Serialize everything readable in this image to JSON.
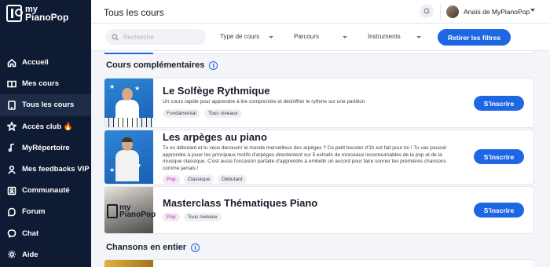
{
  "logo": {
    "line1": "my",
    "line2": "PianoPop"
  },
  "sidebar": {
    "items": [
      {
        "label": "Accueil",
        "icon": "home-icon"
      },
      {
        "label": "Mes cours",
        "icon": "book-icon"
      },
      {
        "label": "Tous les cours",
        "icon": "tablet-icon",
        "active": true
      },
      {
        "label": "Accès club 🔥",
        "icon": "star-icon"
      },
      {
        "label": "MyRépertoire",
        "icon": "music-note-icon"
      },
      {
        "label": "Mes feedbacks VIP",
        "icon": "user-icon"
      },
      {
        "label": "Communauté",
        "icon": "contacts-icon"
      },
      {
        "label": "Forum",
        "icon": "forum-icon"
      },
      {
        "label": "Chat",
        "icon": "chat-icon"
      },
      {
        "label": "Aide",
        "icon": "help-icon"
      }
    ]
  },
  "header": {
    "title": "Tous les cours",
    "user_name": "Anaïs de MyPianoPop"
  },
  "filters": {
    "search_placeholder": "Recherche",
    "type_label": "Type de cours",
    "parcours_label": "Parcours",
    "instruments_label": "Instruments",
    "reset_label": "Retirer les filtres"
  },
  "sections": {
    "complementary": "Cours complémentaires",
    "full_songs": "Chansons en entier"
  },
  "info_glyph": "i",
  "courses": [
    {
      "title": "Le Solfège Rythmique",
      "description": "Un cours rapide pour apprendre à lire comprendre et déchiffrer le rythme sur une partition",
      "tags": [
        "Fondamental",
        "Tous niveaux"
      ],
      "button": "S'inscrire"
    },
    {
      "title": "Les arpèges au piano",
      "description": "Tu es débutant et tu veux découvrir le monde merveilleux des arpèges ? Ce petit booster d'1h est fait pour toi ! Tu vas pouvoir apprendre à jouer les principaux motifs d'arpèges directement sur 5 extraits de morceaux incontournables de la pop et de la musique classique. C'est aussi l'occasion parfaite d'apprendre à embellir un accord pour faire sonner tes premières chansons comme jamais !",
      "tags": [
        "Pop",
        "Classique",
        "Débutant"
      ],
      "button": "S'inscrire"
    },
    {
      "title": "Masterclass Thématiques Piano",
      "description": "",
      "tags": [
        "Pop",
        "Tous niveaux"
      ],
      "button": "S'inscrire"
    }
  ],
  "colors": {
    "sidebar_bg": "#0f1b33",
    "accent": "#1d67e3",
    "pop_tag": "#9b3ba0"
  }
}
